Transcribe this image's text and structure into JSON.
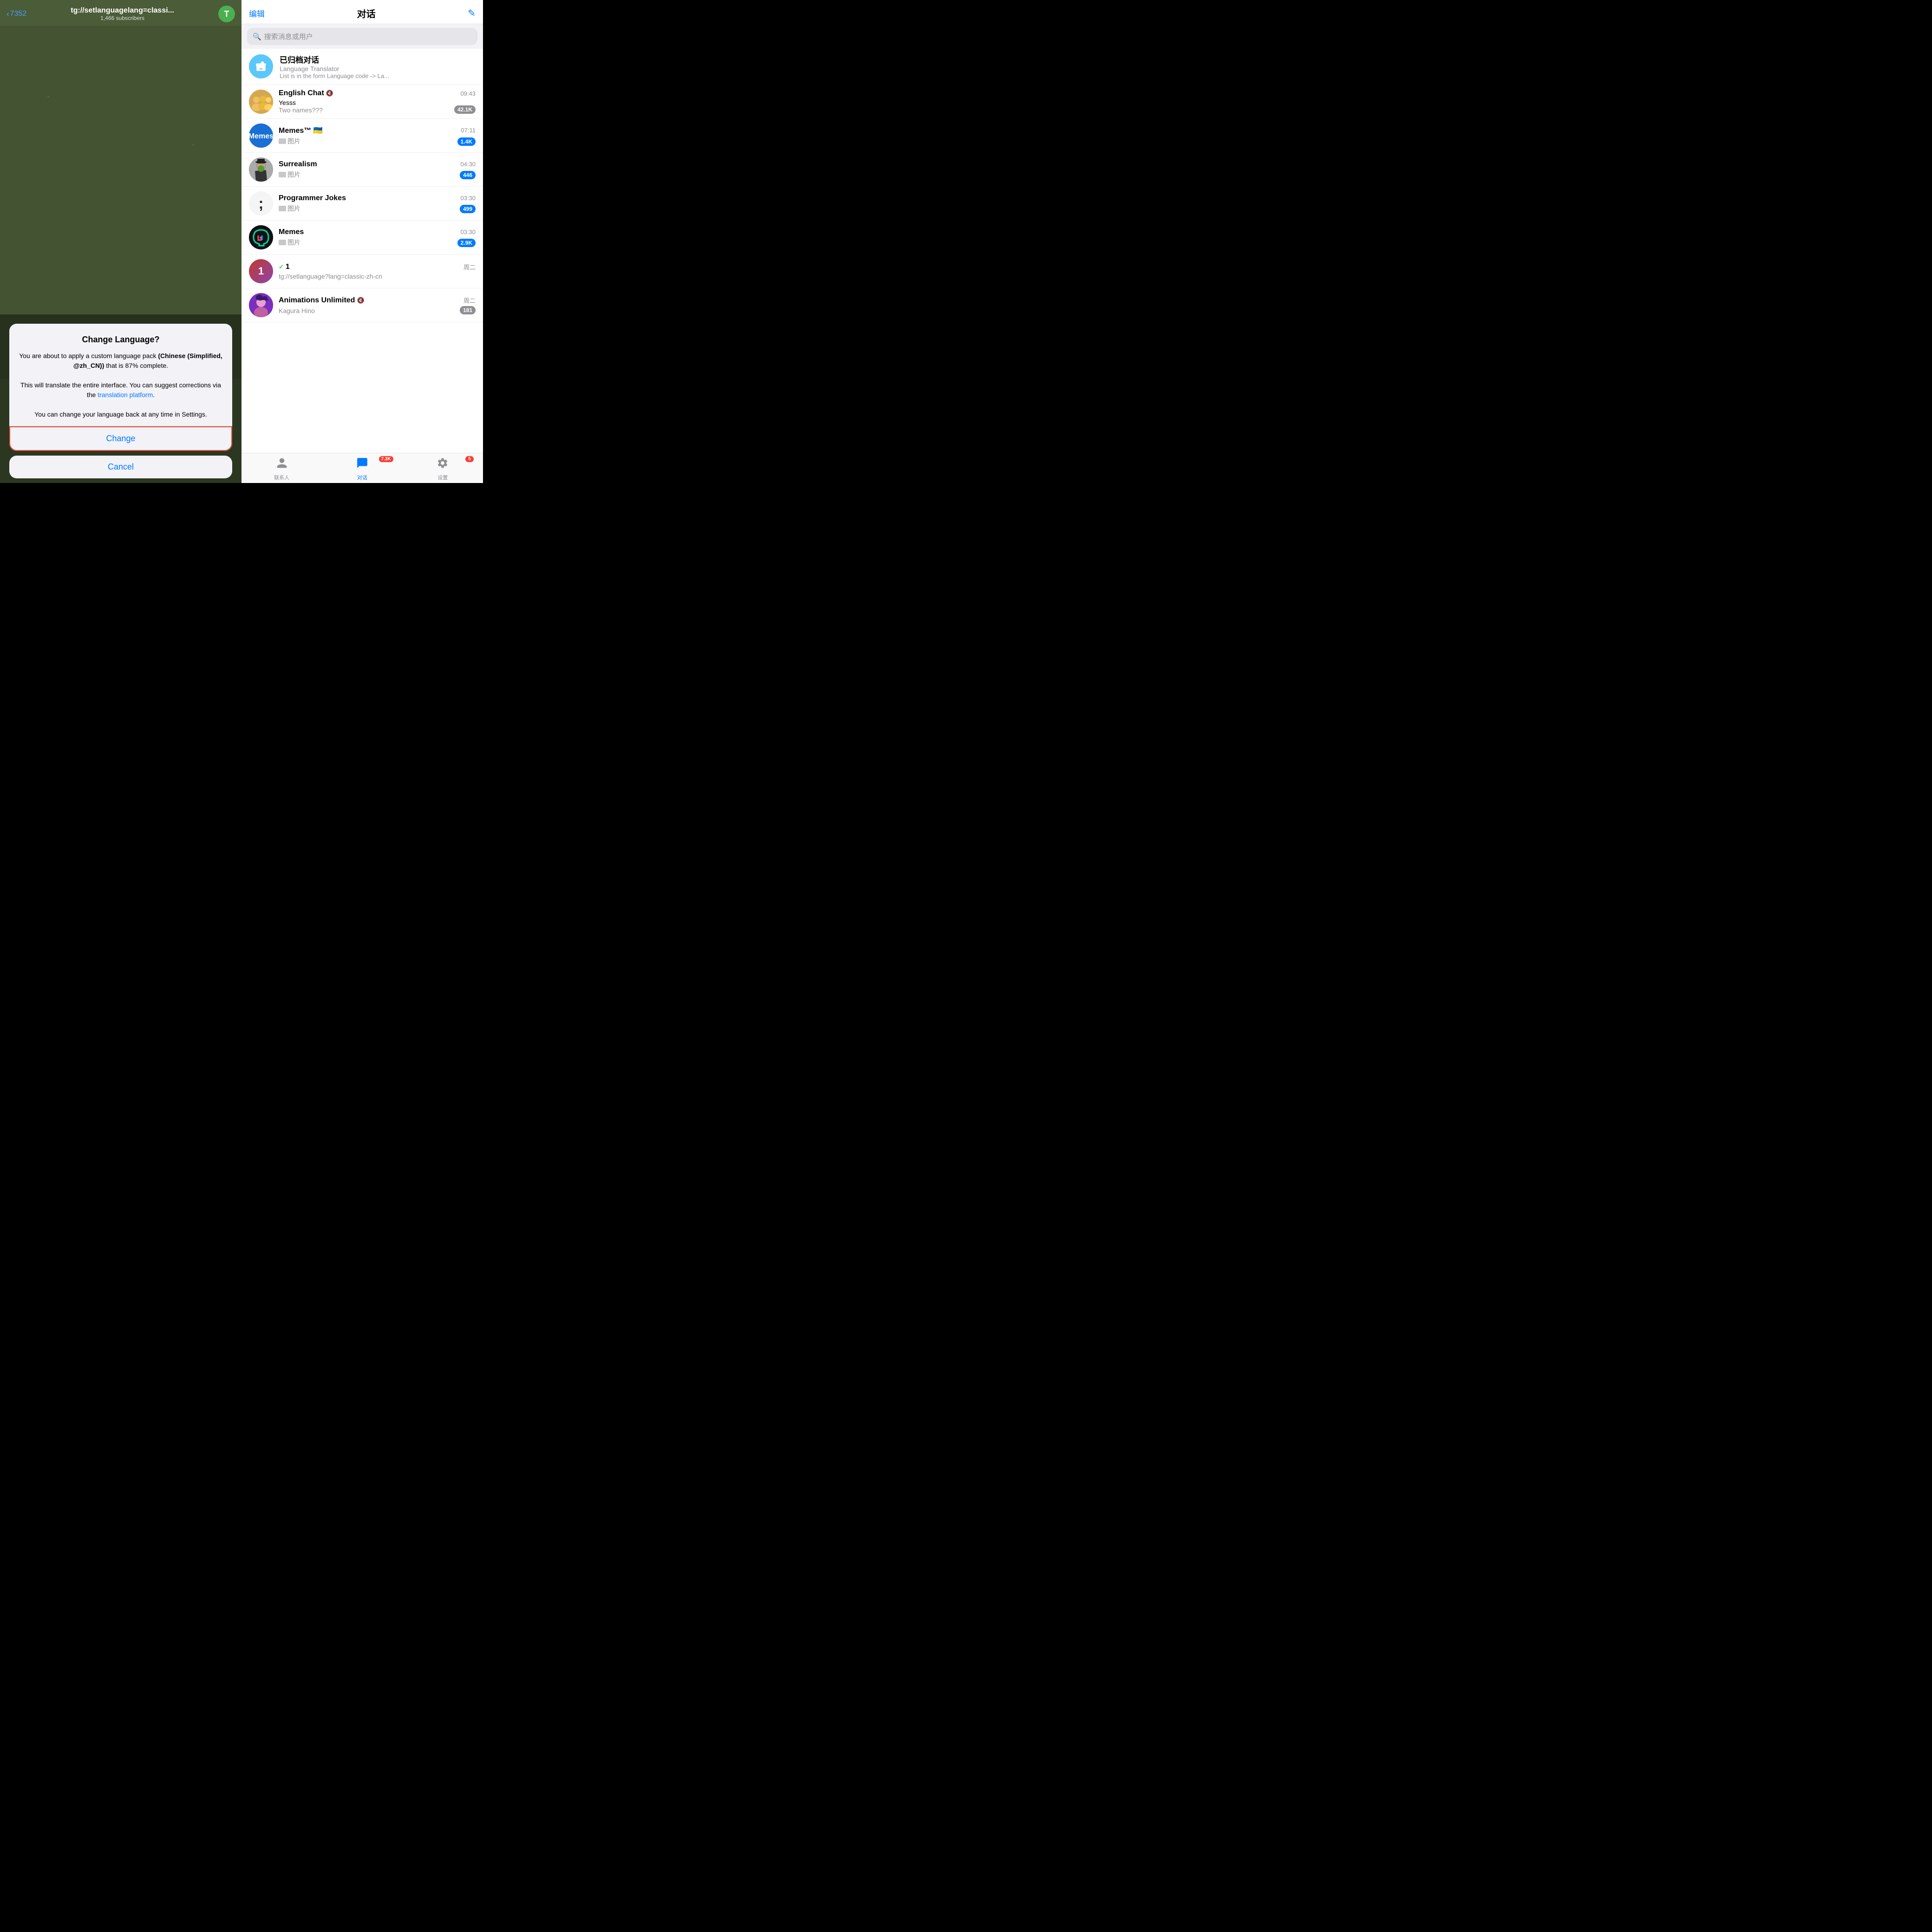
{
  "left": {
    "back_count": "7352",
    "channel_url": "tg://setlanguagelang=classi...",
    "subscribers": "1,466 subscribers",
    "avatar_letter": "T",
    "dialog": {
      "title": "Change Language?",
      "body_line1": "You are about to apply a custom language pack",
      "body_bold": "(Chinese (Simplified, @zh_CN))",
      "body_line2": "that is 87% complete.",
      "body_line3": "This will translate the entire interface. You can suggest corrections via the",
      "link_text": "translation platform",
      "body_line4": ".",
      "body_line5": "You can change your language back at any time in Settings.",
      "change_label": "Change",
      "cancel_label": "Cancel"
    }
  },
  "right": {
    "header": {
      "edit_label": "编辑",
      "title": "对话",
      "compose_icon": "✏️"
    },
    "search": {
      "placeholder": "搜索消息或用户"
    },
    "archived": {
      "title": "已归档对话",
      "sub1": "Language Translator",
      "sub2": "List is in the form  Language code -> La..."
    },
    "chats": [
      {
        "id": "english-chat",
        "name": "English Chat",
        "muted": true,
        "preview_sender": "Yesss",
        "preview_msg": "Two names???",
        "time": "09:43",
        "badge": "42.1K",
        "badge_gray": false
      },
      {
        "id": "memes-channel",
        "name": "Memes™ 🇺🇦",
        "muted": false,
        "preview_sender": "",
        "preview_msg": "图片",
        "has_img": true,
        "time": "07:11",
        "badge": "1.4K",
        "badge_gray": false
      },
      {
        "id": "surrealism",
        "name": "Surrealism",
        "muted": false,
        "preview_sender": "",
        "preview_msg": "图片",
        "has_img": true,
        "time": "04:30",
        "badge": "446",
        "badge_gray": false
      },
      {
        "id": "programmer-jokes",
        "name": "Programmer Jokes",
        "muted": false,
        "preview_sender": "",
        "preview_msg": "图片",
        "has_img": true,
        "time": "03:30",
        "badge": "499",
        "badge_gray": false
      },
      {
        "id": "memes9",
        "name": "Memes",
        "muted": false,
        "preview_sender": "",
        "preview_msg": "图片",
        "has_img": true,
        "time": "03:30",
        "badge": "2.9K",
        "badge_gray": false
      },
      {
        "id": "chat-1",
        "name": "1",
        "muted": false,
        "checkmark": true,
        "preview_msg": "tg://setlanguage?lang=classic-zh-cn",
        "time": "周二",
        "badge": null
      },
      {
        "id": "animations-unlimited",
        "name": "Animations Unlimited",
        "muted": true,
        "preview_msg": "Kagura Hino",
        "time": "周二",
        "badge": "181",
        "badge_gray": true
      }
    ],
    "tabs": [
      {
        "id": "contacts",
        "label": "联系人",
        "icon": "👤",
        "active": false,
        "badge": null
      },
      {
        "id": "chats",
        "label": "对话",
        "icon": "💬",
        "active": true,
        "badge": "7.3K"
      },
      {
        "id": "settings",
        "label": "设置",
        "icon": "⬇️",
        "active": false,
        "badge": "5"
      }
    ]
  }
}
